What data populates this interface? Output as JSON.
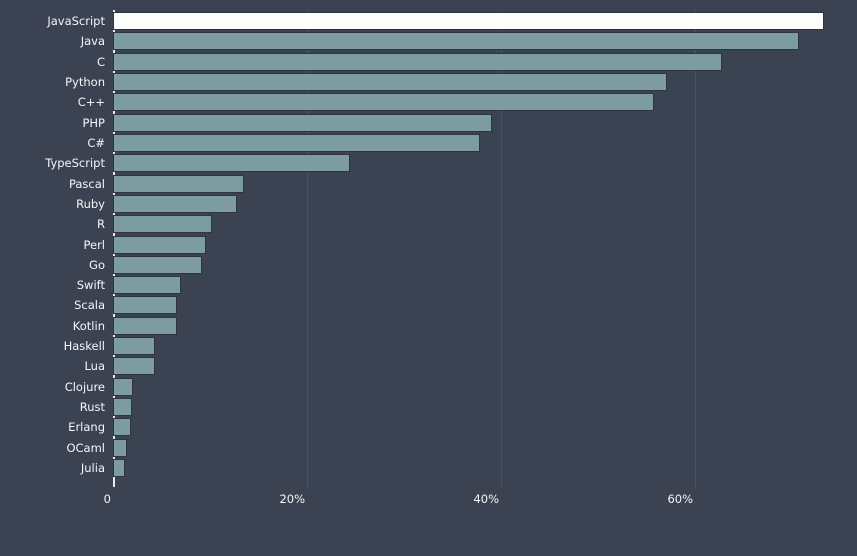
{
  "chart_data": {
    "type": "bar",
    "orientation": "horizontal",
    "title": "",
    "subtitle": "",
    "xlabel": "",
    "ylabel": "",
    "xlim": [
      0,
      76.7
    ],
    "grid": true,
    "legend": null,
    "xticks": [
      {
        "value": 0,
        "label": "0"
      },
      {
        "value": 20,
        "label": "20%"
      },
      {
        "value": 40,
        "label": "40%"
      },
      {
        "value": 60,
        "label": "60%"
      }
    ],
    "categories": [
      "JavaScript",
      "Java",
      "C",
      "Python",
      "C++",
      "PHP",
      "C#",
      "TypeScript",
      "Pascal",
      "Ruby",
      "R",
      "Perl",
      "Go",
      "Swift",
      "Scala",
      "Kotlin",
      "Haskell",
      "Lua",
      "Clojure",
      "Rust",
      "Erlang",
      "OCaml",
      "Julia"
    ],
    "values": [
      73.3,
      70.7,
      62.8,
      57.1,
      55.8,
      39.1,
      37.8,
      24.4,
      13.5,
      12.8,
      10.2,
      9.6,
      9.2,
      7.0,
      6.6,
      6.6,
      4.3,
      4.3,
      2.1,
      2.0,
      1.9,
      1.4,
      1.2
    ],
    "highlight_index": 0,
    "colors": {
      "background": "#3b4252",
      "bar": "#7d9ca1",
      "bar_highlight": "#fdfdfb",
      "bar_border": "#2e3440",
      "gridline": "#4b5263",
      "axis_line": "#e8ecf2",
      "text": "#f4f6f9"
    }
  }
}
